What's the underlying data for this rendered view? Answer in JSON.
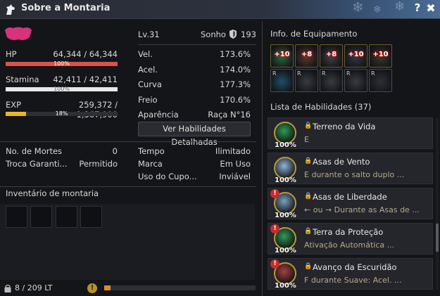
{
  "window": {
    "title": "Sobre a Montaria",
    "help_label": "?",
    "close_label": "✖"
  },
  "mount": {
    "level": "Lv.31",
    "sonho_label": "Sonho",
    "sonho_value": "193"
  },
  "stats": {
    "hp_label": "HP",
    "hp_value": "64,344 / 64,344",
    "hp_pct": "100%",
    "hp_fraction": 1.0,
    "stamina_label": "Stamina",
    "stamina_value": "42,411 / 42,411",
    "stamina_pct": "100%",
    "stamina_fraction": 1.0,
    "exp_label": "EXP",
    "exp_value": "259,372 / 1,367,900",
    "exp_pct": "18%",
    "exp_fraction": 0.18
  },
  "attributes": [
    {
      "label": "Vel.",
      "value": "173.6%"
    },
    {
      "label": "Acel.",
      "value": "174.0%"
    },
    {
      "label": "Curva",
      "value": "177.3%"
    },
    {
      "label": "Freio",
      "value": "170.6%"
    },
    {
      "label": "Aparência",
      "value": "Raça N°16"
    }
  ],
  "detail_button": "Ver Habilidades Detalhadas",
  "left_info": [
    {
      "label": "No. de Mortes",
      "value": "0"
    },
    {
      "label": "Troca Garanti...",
      "value": "Permitido"
    }
  ],
  "right_info": [
    {
      "label": "Tempo",
      "value": "Ilimitado"
    },
    {
      "label": "Marca",
      "value": "Em Uso"
    },
    {
      "label": "Uso do Cupo...",
      "value": "Inviável"
    }
  ],
  "inventory": {
    "title": "Inventário de montaria",
    "weight": "8 / 209 LT",
    "weight_fraction": 0.04
  },
  "equipment": {
    "title": "Info. de Equipamento",
    "top_row": [
      "+10",
      "+8",
      "+8",
      "+10",
      "+10"
    ],
    "bottom_tag": "R"
  },
  "skills": {
    "title": "Lista de Habilidades (37)",
    "items": [
      {
        "name": "Terreno da Vida",
        "desc": "E",
        "pct": "100%",
        "warn": false,
        "color": "#2f9a55"
      },
      {
        "name": "Asas de Vento",
        "desc": "E durante o salto duplo ...",
        "pct": "100%",
        "warn": false,
        "color": "#8fb4d8"
      },
      {
        "name": "Asas de Liberdade",
        "desc": "← ou → Durante as Asas de ...",
        "pct": "100%",
        "warn": true,
        "color": "#7aa0c0"
      },
      {
        "name": "Terra da Proteção",
        "desc": "Ativação Automática ...",
        "pct": "100%",
        "warn": true,
        "color": "#2f9a55"
      },
      {
        "name": "Avanço da Escuridão",
        "desc": "F durante Suave: Acel. ...",
        "pct": "100%",
        "warn": true,
        "color": "#a54040"
      }
    ],
    "warn_glyph": "!",
    "lock_glyph": "🔒"
  },
  "colors": {
    "hp": "#d9534b",
    "stamina": "#e8e8e8",
    "exp": "#e8b52a",
    "accent": "#b89a3a"
  }
}
